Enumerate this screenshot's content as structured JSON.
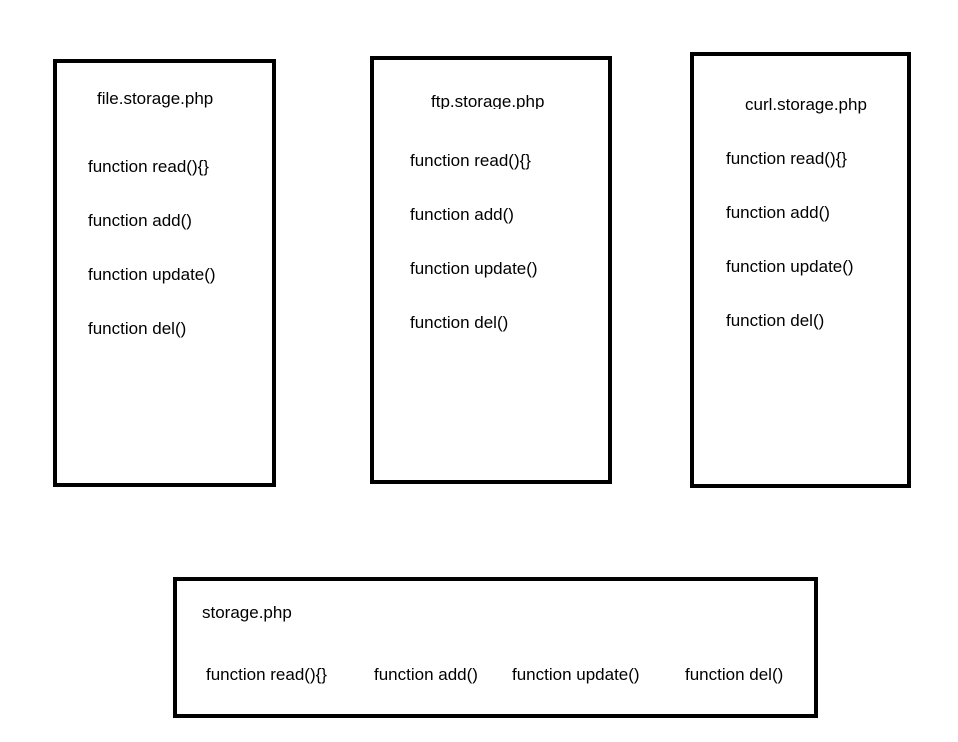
{
  "boxes": {
    "file_storage": {
      "title": "file.storage.php",
      "functions": [
        "function read(){}",
        "function add()",
        "function update()",
        "function del()"
      ]
    },
    "ftp_storage": {
      "title": "ftp.storage.php",
      "functions": [
        "function read(){}",
        "function add()",
        "function update()",
        "function del()"
      ]
    },
    "curl_storage": {
      "title": "curl.storage.php",
      "functions": [
        "function read(){}",
        "function add()",
        "function update()",
        "function del()"
      ]
    },
    "storage": {
      "title": "storage.php",
      "functions": [
        "function read(){}",
        "function add()",
        "function update()",
        "function del()"
      ]
    }
  },
  "colors": {
    "border": "#000000",
    "background": "#ffffff",
    "text": "#000000"
  }
}
